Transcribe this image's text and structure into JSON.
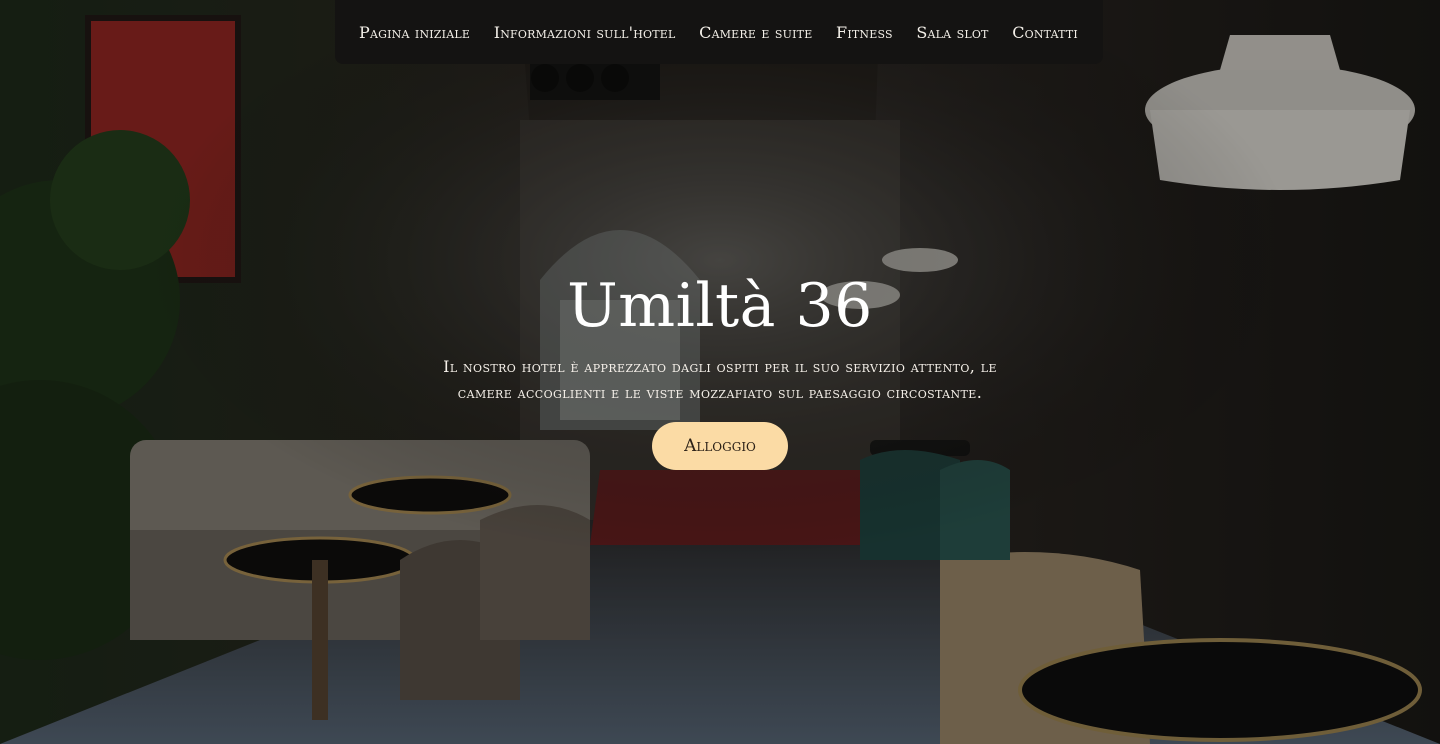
{
  "nav": {
    "items": [
      {
        "label": "Pagina iniziale"
      },
      {
        "label": "Informazioni sull'hotel"
      },
      {
        "label": "Camere e suite"
      },
      {
        "label": "Fitness"
      },
      {
        "label": "Sala slot"
      },
      {
        "label": "Contatti"
      }
    ]
  },
  "hero": {
    "title": "Umiltà 36",
    "subtitle": "Il nostro hotel è apprezzato dagli ospiti per il suo servizio attento, le camere accoglienti e le viste mozzafiato sul paesaggio circostante.",
    "cta_label": "Alloggio"
  },
  "colors": {
    "nav_bg": "#141312",
    "cta_bg": "#fbdba5",
    "cta_text": "#2b2117"
  }
}
